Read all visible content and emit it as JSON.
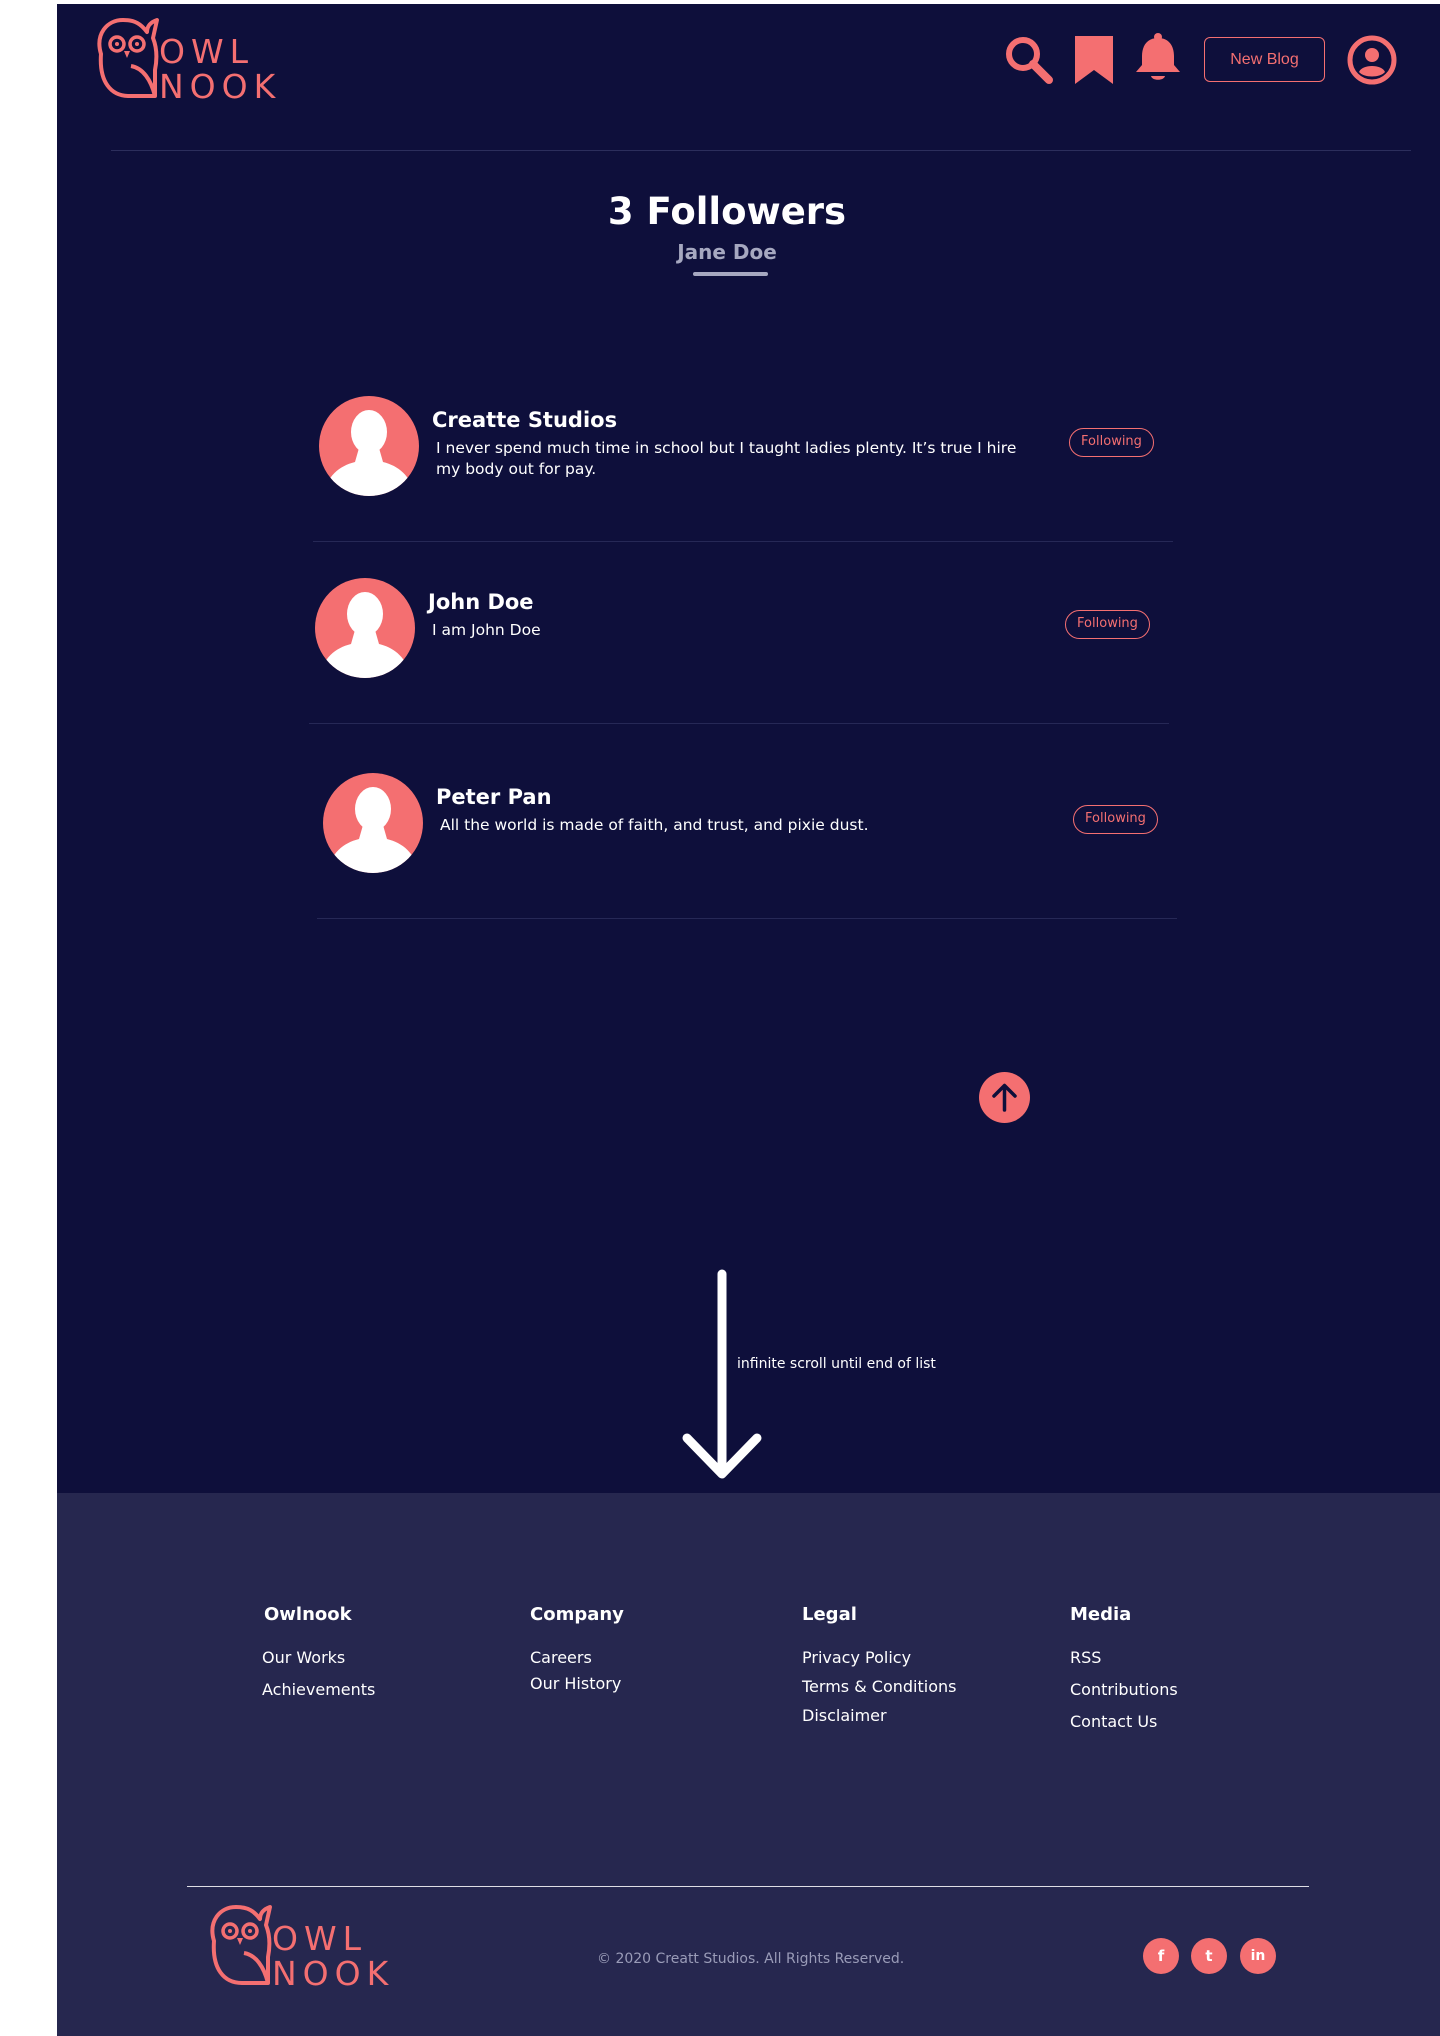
{
  "header": {
    "logo_top": "OWL",
    "logo_bottom": "NOOK",
    "new_blog_label": "New Blog",
    "icons": [
      "search-icon",
      "bookmark-icon",
      "bell-icon",
      "user-icon"
    ]
  },
  "title": {
    "heading": "3 Followers",
    "subheading": "Jane Doe"
  },
  "followers": [
    {
      "name": "Creatte Studios",
      "bio_line1": "I never spend much time in school but I taught ladies plenty. It’s true I hire",
      "bio_line2": "my body out for pay.",
      "button": "Following"
    },
    {
      "name": "John Doe",
      "bio_line1": "I am John Doe",
      "bio_line2": "",
      "button": "Following"
    },
    {
      "name": "Peter Pan",
      "bio_line1": "All the world is made of faith, and trust, and pixie dust.",
      "bio_line2": "",
      "button": "Following"
    }
  ],
  "annotation": {
    "text": "infinite scroll until end of list"
  },
  "footer": {
    "columns": [
      {
        "heading": "Owlnook",
        "links": [
          "Our Works",
          "Achievements"
        ]
      },
      {
        "heading": "Company",
        "links": [
          "Careers",
          "Our History"
        ]
      },
      {
        "heading": "Legal",
        "links": [
          "Privacy Policy",
          "Terms & Conditions",
          "Disclaimer"
        ]
      },
      {
        "heading": "Media",
        "links": [
          "RSS",
          "Contributions",
          "Contact Us"
        ]
      }
    ],
    "logo_top": "OWL",
    "logo_bottom": "NOOK",
    "copyright": "© 2020 Creatt Studios. All Rights Reserved.",
    "social": [
      {
        "icon": "facebook-icon",
        "glyph": "f"
      },
      {
        "icon": "twitter-icon",
        "glyph": "t"
      },
      {
        "icon": "linkedin-icon",
        "glyph": "in"
      }
    ]
  },
  "colors": {
    "background": "#0e0f3b",
    "footer_background": "#26274f",
    "accent": "#f46f71",
    "text": "#ffffff",
    "muted": "#a6a8c0"
  }
}
